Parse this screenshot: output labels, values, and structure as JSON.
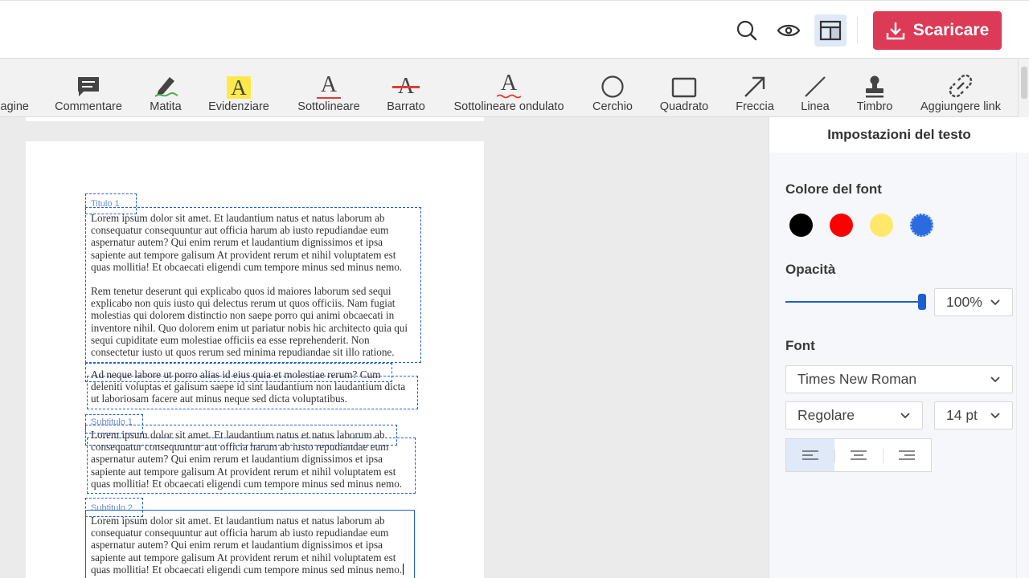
{
  "topbar": {
    "download_label": "Scaricare",
    "icons": [
      "search-icon",
      "eye-icon",
      "layout-icon",
      "download-icon"
    ]
  },
  "toolbar": {
    "tools": [
      {
        "id": "pages",
        "label": "agine",
        "icon": "pages-icon"
      },
      {
        "id": "comment",
        "label": "Commentare",
        "icon": "comment-icon"
      },
      {
        "id": "pencil",
        "label": "Matita",
        "icon": "pencil-icon"
      },
      {
        "id": "highlight",
        "label": "Evidenziare",
        "icon": "highlight-icon"
      },
      {
        "id": "underline",
        "label": "Sottolineare",
        "icon": "underline-icon"
      },
      {
        "id": "strikethrough",
        "label": "Barrato",
        "icon": "strikethrough-icon"
      },
      {
        "id": "wavy",
        "label": "Sottolineare ondulato",
        "icon": "wavy-underline-icon"
      },
      {
        "id": "circle",
        "label": "Cerchio",
        "icon": "circle-icon"
      },
      {
        "id": "square",
        "label": "Quadrato",
        "icon": "square-icon"
      },
      {
        "id": "arrow",
        "label": "Freccia",
        "icon": "arrow-icon"
      },
      {
        "id": "line",
        "label": "Linea",
        "icon": "line-icon"
      },
      {
        "id": "stamp",
        "label": "Timbro",
        "icon": "stamp-icon"
      },
      {
        "id": "link",
        "label": "Aggiungere link",
        "icon": "link-icon"
      }
    ],
    "glyph_letter": "A"
  },
  "document": {
    "heading1": "Titulo 1",
    "para1": [
      "Lorem ipsum dolor sit amet. Et laudantium natus et natus laborum ab",
      "consequatur consequuntur aut officia harum ab iusto repudiandae eum",
      "aspernatur autem? Qui enim rerum et laudantium dignissimos et ipsa",
      "sapiente aut tempore galisum At provident rerum et nihil voluptatem est",
      "quas mollitia! Et obcaecati eligendi cum tempore minus sed minus nemo."
    ],
    "para2": [
      "Rem tenetur deserunt qui explicabo quos id maiores laborum sed sequi",
      "explicabo non quis iusto qui delectus rerum ut quos officiis. Nam fugiat",
      "molestias qui dolorem distinctio non saepe porro qui animi obcaecati in",
      "inventore nihil. Quo dolorem enim ut pariatur nobis hic architecto quia qui",
      "sequi cupiditate eum molestiae officiis ea esse reprehenderit. Non",
      "consectetur iusto ut quos rerum sed minima repudiandae sit illo ratione."
    ],
    "para3": [
      "Ad neque labore ut porro alias id eius quia et molestiae rerum? Cum",
      "deleniti voluptas et galisum saepe id sint laudantium non laudantium dicta",
      "ut laboriosam facere aut minus neque sed dicta voluptatibus."
    ],
    "heading2": "Subtitulo 1",
    "para4": [
      "Lorem ipsum dolor sit amet. Et laudantium natus et natus laborum ab",
      "consequatur consequuntur aut officia harum ab iusto repudiandae eum",
      "aspernatur autem? Qui enim rerum et laudantium dignissimos et ipsa",
      "sapiente aut tempore galisum At provident rerum et nihil voluptatem est",
      "quas mollitia! Et obcaecati eligendi cum tempore minus sed minus nemo."
    ],
    "heading3": "Subtitulo 2",
    "para5": [
      "Lorem ipsum dolor sit amet. Et laudantium natus et natus laborum ab",
      "consequatur consequuntur aut officia harum ab iusto repudiandae eum",
      "aspernatur autem? Qui enim rerum et laudantium dignissimos et ipsa",
      "sapiente aut tempore galisum At provident rerum et nihil voluptatem est",
      "quas mollitia! Et obcaecati eligendi cum tempore minus sed minus nemo."
    ]
  },
  "panel": {
    "title": "Impostazioni del testo",
    "font_color_title": "Colore del font",
    "colors": [
      "#000000",
      "#ff0000",
      "#ffe86a",
      "#2b6be0"
    ],
    "opacity_title": "Opacità",
    "opacity_fraction": 1.0,
    "opacity_value": "100%",
    "font_title": "Font",
    "font_family": "Times New Roman",
    "font_style": "Regolare",
    "font_size": "14 pt",
    "alignment": "left"
  }
}
